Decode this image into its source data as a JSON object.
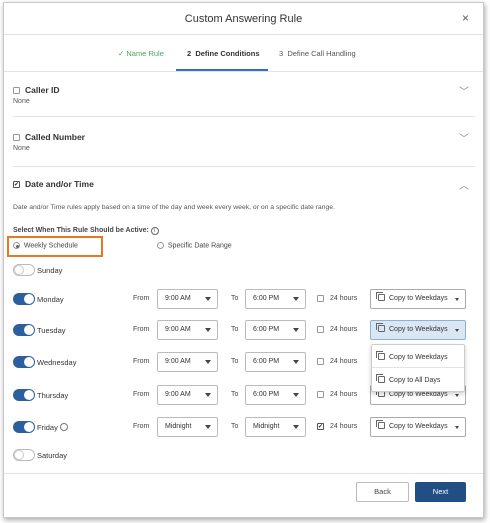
{
  "dialog": {
    "title": "Custom Answering Rule",
    "close_glyph": "×"
  },
  "steps": {
    "step1": "✓ Name Rule",
    "step2_num": "2",
    "step2": "Define Conditions",
    "step3_num": "3",
    "step3": "Define Call Handling"
  },
  "sections": {
    "caller_id": {
      "title": "Caller ID",
      "value": "None",
      "checked": false
    },
    "called_number": {
      "title": "Called Number",
      "value": "None",
      "checked": false
    },
    "date_time": {
      "title": "Date and/or Time",
      "checked": true,
      "description": "Date and/or Time rules apply based on a time of the day and week every week, or on a specific date range.",
      "select_label": "Select When This Rule Should be Active:",
      "option_weekly": "Weekly Schedule",
      "option_range": "Specific Date Range",
      "selected": "Weekly Schedule"
    }
  },
  "schedule": {
    "from_label": "From",
    "to_label": "To",
    "hours_label": "24 hours",
    "days": [
      {
        "name": "Sunday",
        "enabled": false
      },
      {
        "name": "Monday",
        "enabled": true,
        "from": "9:00 AM",
        "to": "6:00 PM",
        "all_day": false,
        "copy": "Copy to Weekdays"
      },
      {
        "name": "Tuesday",
        "enabled": true,
        "from": "9:00 AM",
        "to": "6:00 PM",
        "all_day": false,
        "copy": "Copy to Weekdays"
      },
      {
        "name": "Wednesday",
        "enabled": true,
        "from": "9:00 AM",
        "to": "6:00 PM",
        "all_day": false,
        "copy": "Copy to Weekdays"
      },
      {
        "name": "Thursday",
        "enabled": true,
        "from": "9:00 AM",
        "to": "6:00 PM",
        "all_day": false,
        "copy": "Copy to Weekdays"
      },
      {
        "name": "Friday",
        "enabled": true,
        "from": "Midnight",
        "to": "Midnight",
        "all_day": true,
        "copy": "Copy to Weekdays"
      },
      {
        "name": "Saturday",
        "enabled": false
      }
    ]
  },
  "copy_menu": {
    "items": [
      "Copy to Weekdays",
      "Copy to All Days"
    ]
  },
  "footer": {
    "back": "Back",
    "next": "Next"
  },
  "colors": {
    "accent": "#214e85",
    "toggle_on": "#2d5f9e",
    "step_done": "#4aa35c",
    "highlight": "#e87722"
  }
}
